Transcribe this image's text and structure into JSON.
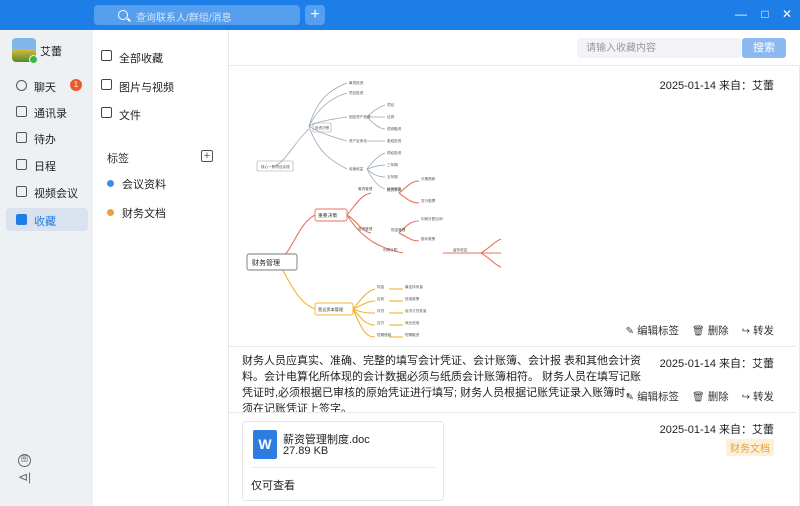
{
  "titlebar": {
    "search_placeholder": "查询联系人/群组/消息",
    "plus_label": "+",
    "minimize": "—",
    "maximize": "□",
    "close": "✕"
  },
  "user": {
    "name": "艾蕾"
  },
  "nav": {
    "items": [
      {
        "label": "聊天",
        "icon": "chat-icon",
        "badge": "1"
      },
      {
        "label": "通讯录",
        "icon": "contacts-icon"
      },
      {
        "label": "待办",
        "icon": "todo-icon"
      },
      {
        "label": "日程",
        "icon": "calendar-icon"
      },
      {
        "label": "视频会议",
        "icon": "video-meeting-icon"
      },
      {
        "label": "收藏",
        "icon": "favorites-icon",
        "active": true
      }
    ],
    "bottom_icon_1": "图",
    "bottom_icon_2": "⊲|"
  },
  "favorites_menu": {
    "items": [
      {
        "label": "全部收藏",
        "icon": "star-box-icon"
      },
      {
        "label": "图片与视频",
        "icon": "image-icon"
      },
      {
        "label": "文件",
        "icon": "file-icon"
      }
    ],
    "tags_heading": "标签",
    "tags_add": "+",
    "tags": [
      {
        "label": "会议资料",
        "color": "#3a8ee6"
      },
      {
        "label": "财务文档",
        "color": "#e6a23c"
      }
    ]
  },
  "main": {
    "search_placeholder": "请输入收藏内容",
    "search_button": "搜索",
    "cards": [
      {
        "meta": "2025-01-14 来自：艾蕾",
        "actions": [
          "编辑标签",
          "删除",
          "转发"
        ],
        "mindmap": {
          "root": "财务管理",
          "branch1": "重要决策",
          "branch2": "营运资本管理",
          "top_root": "核心一阶项目实践",
          "top_branch": "投资决策",
          "top_nodes": [
            "筹资投资",
            "项目投资",
            "固定资产投资",
            "资产证券化",
            "经营权益",
            "内部投资",
            "外部投资"
          ],
          "top_leaves": [
            "项目",
            "证券",
            "债券融资",
            "股权投资",
            "债权投资",
            "三年期",
            "五年期",
            "持有现金"
          ],
          "b1_nodes": [
            "筹资管理",
            "投资管理",
            "利润分配"
          ],
          "b1_leaves": [
            "融资需求",
            "长期借款",
            "发行股票",
            "现金管理",
            "利润分配比例",
            "股利政策",
            "留存收益"
          ],
          "b2_nodes": [
            "现金",
            "应收",
            "存货",
            "应付",
            "短期借款"
          ],
          "b2_leaves": [
            "最佳持有量",
            "信用政策",
            "经济订货批量",
            "商业信用",
            "短期融资"
          ]
        }
      },
      {
        "meta": "2025-01-14 来自：艾蕾",
        "text": "财务人员应真实、准确、完整的填写会计凭证、会计账簿、会计报 表和其他会计资料。会计电算化所体现的会计数据必须与纸质会计账簿相符。 财务人员在填写记账凭证时,必须根据已审核的原始凭证进行填写; 财务人员根据记账凭证录入账簿时，须在记账凭证上签字。",
        "actions": [
          "编辑标签",
          "删除",
          "转发"
        ]
      },
      {
        "meta": "2025-01-14 来自：艾蕾",
        "file_icon": "W",
        "file_name": "薪资管理制度.doc",
        "file_size": "27.89 KB",
        "file_note": "仅可查看",
        "tag": "财务文档"
      }
    ]
  },
  "colors": {
    "brand": "#1e7ee8",
    "badge": "#f2552c",
    "mindmap_red": "#e8735a",
    "mindmap_yellow": "#f0b429",
    "mindmap_gray": "#9aa6b2"
  }
}
